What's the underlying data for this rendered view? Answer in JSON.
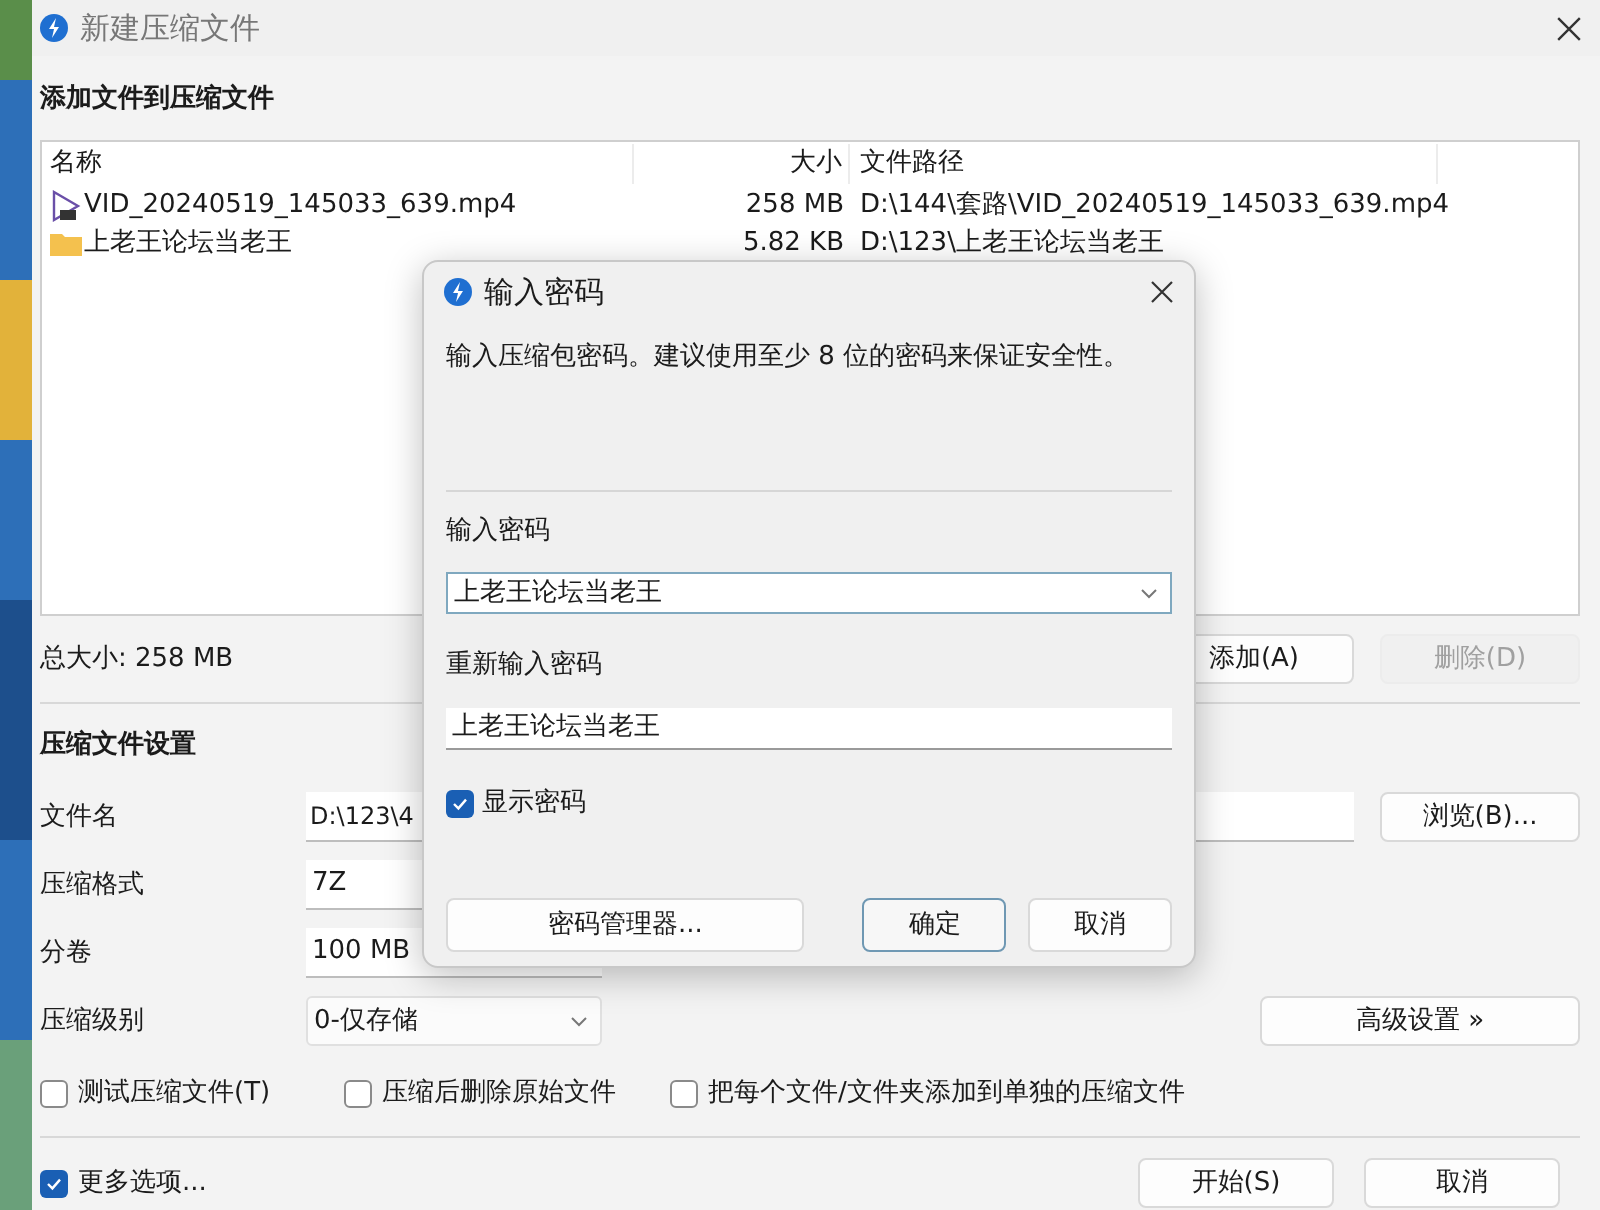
{
  "window": {
    "title": "新建压缩文件"
  },
  "files_section": {
    "title": "添加文件到压缩文件"
  },
  "file_list": {
    "columns": [
      "名称",
      "大小",
      "文件路径"
    ],
    "rows": [
      {
        "kind": "video",
        "name": "VID_20240519_145033_639.mp4",
        "size": "258 MB",
        "path": "D:\\144\\套路\\VID_20240519_145033_639.mp4"
      },
      {
        "kind": "folder",
        "name": "上老王论坛当老王",
        "size": "5.82 KB",
        "path": "D:\\123\\上老王论坛当老王"
      }
    ]
  },
  "total_size": "总大小: 258 MB",
  "list_buttons": [
    {
      "label": "添加(A)",
      "disabled": false
    },
    {
      "label": "删除(D)",
      "disabled": true
    }
  ],
  "settings": {
    "title": "压缩文件设置",
    "browse_button": "浏览(B)...",
    "advanced_button": "高级设置 »",
    "fields": [
      {
        "kind": "wide",
        "label": "文件名",
        "value": "D:\\123\\4"
      },
      {
        "kind": "text",
        "label": "压缩格式",
        "value": "7Z"
      },
      {
        "kind": "text",
        "label": "分卷",
        "value": "100 MB"
      },
      {
        "kind": "dropdown",
        "label": "压缩级别",
        "value": "0-仅存储"
      }
    ]
  },
  "options": [
    {
      "label": "测试压缩文件(T)",
      "checked": false
    },
    {
      "label": "压缩后删除原始文件",
      "checked": false
    },
    {
      "label": "把每个文件/文件夹添加到单独的压缩文件",
      "checked": false
    }
  ],
  "more_options": {
    "label": "更多选项...",
    "checked": true
  },
  "footer_buttons": [
    {
      "label": "开始(S)"
    },
    {
      "label": "取消"
    }
  ],
  "password_dialog": {
    "title": "输入密码",
    "message": "输入压缩包密码。建议使用至少 8 位的密码来保证安全性。",
    "password_label": "输入密码",
    "password_value": "上老王论坛当老王",
    "confirm_label": "重新输入密码",
    "confirm_value": "上老王论坛当老王",
    "show_password": {
      "label": "显示密码",
      "checked": true
    },
    "buttons": [
      {
        "kind": "wide",
        "label": "密码管理器...",
        "default": false
      },
      {
        "kind": "normal",
        "label": "确定",
        "default": true
      },
      {
        "kind": "normal",
        "label": "取消",
        "default": false
      }
    ]
  }
}
